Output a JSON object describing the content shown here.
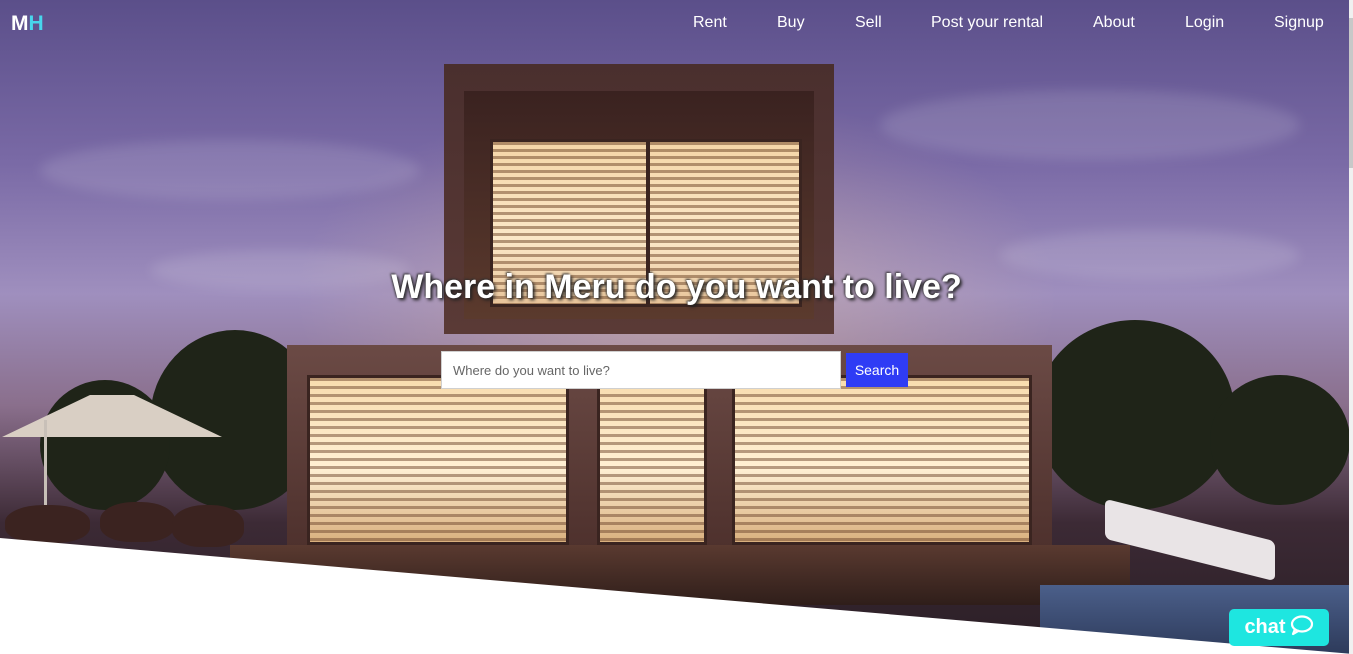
{
  "brand": {
    "logo_m": "M",
    "logo_h": "H"
  },
  "nav": {
    "items": [
      {
        "label": "Rent"
      },
      {
        "label": "Buy"
      },
      {
        "label": "Sell"
      },
      {
        "label": "Post your rental"
      },
      {
        "label": "About"
      },
      {
        "label": "Login"
      },
      {
        "label": "Signup"
      }
    ]
  },
  "hero": {
    "headline": "Where in Meru do you want to live?",
    "search_placeholder": "Where do you want to live?",
    "search_value": "",
    "search_button": "Search"
  },
  "chat": {
    "label": "chat",
    "icon": "speech-bubble-icon"
  },
  "colors": {
    "logo_accent": "#48d6ec",
    "search_button_bg": "#2f3cf5",
    "chat_button_bg": "#1ee6e0"
  }
}
